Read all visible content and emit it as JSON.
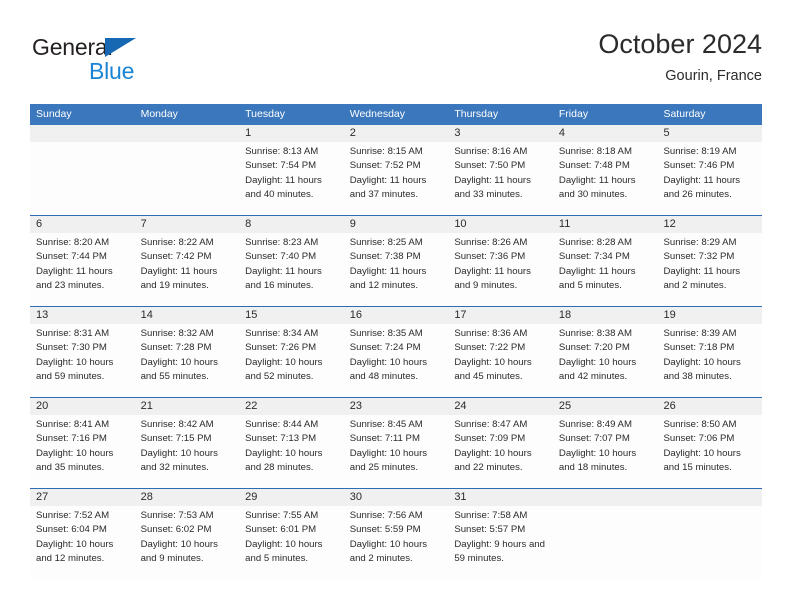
{
  "brand": {
    "name_part1": "General",
    "name_part2": "Blue",
    "triangle_color": "#1668b3",
    "blue_color": "#1c84d4"
  },
  "header": {
    "title": "October 2024",
    "subtitle": "Gourin, France"
  },
  "theme": {
    "header_blue": "#3b77bc",
    "row_separator_blue": "#2f6cb3",
    "daynum_band_gray": "#f0f0f0",
    "text_color": "#2b2b2b"
  },
  "weekdays": [
    "Sunday",
    "Monday",
    "Tuesday",
    "Wednesday",
    "Thursday",
    "Friday",
    "Saturday"
  ],
  "weeks": [
    [
      {
        "day": "",
        "sunrise": "",
        "sunset": "",
        "daylight": ""
      },
      {
        "day": "",
        "sunrise": "",
        "sunset": "",
        "daylight": ""
      },
      {
        "day": "1",
        "sunrise": "Sunrise: 8:13 AM",
        "sunset": "Sunset: 7:54 PM",
        "daylight": "Daylight: 11 hours and 40 minutes."
      },
      {
        "day": "2",
        "sunrise": "Sunrise: 8:15 AM",
        "sunset": "Sunset: 7:52 PM",
        "daylight": "Daylight: 11 hours and 37 minutes."
      },
      {
        "day": "3",
        "sunrise": "Sunrise: 8:16 AM",
        "sunset": "Sunset: 7:50 PM",
        "daylight": "Daylight: 11 hours and 33 minutes."
      },
      {
        "day": "4",
        "sunrise": "Sunrise: 8:18 AM",
        "sunset": "Sunset: 7:48 PM",
        "daylight": "Daylight: 11 hours and 30 minutes."
      },
      {
        "day": "5",
        "sunrise": "Sunrise: 8:19 AM",
        "sunset": "Sunset: 7:46 PM",
        "daylight": "Daylight: 11 hours and 26 minutes."
      }
    ],
    [
      {
        "day": "6",
        "sunrise": "Sunrise: 8:20 AM",
        "sunset": "Sunset: 7:44 PM",
        "daylight": "Daylight: 11 hours and 23 minutes."
      },
      {
        "day": "7",
        "sunrise": "Sunrise: 8:22 AM",
        "sunset": "Sunset: 7:42 PM",
        "daylight": "Daylight: 11 hours and 19 minutes."
      },
      {
        "day": "8",
        "sunrise": "Sunrise: 8:23 AM",
        "sunset": "Sunset: 7:40 PM",
        "daylight": "Daylight: 11 hours and 16 minutes."
      },
      {
        "day": "9",
        "sunrise": "Sunrise: 8:25 AM",
        "sunset": "Sunset: 7:38 PM",
        "daylight": "Daylight: 11 hours and 12 minutes."
      },
      {
        "day": "10",
        "sunrise": "Sunrise: 8:26 AM",
        "sunset": "Sunset: 7:36 PM",
        "daylight": "Daylight: 11 hours and 9 minutes."
      },
      {
        "day": "11",
        "sunrise": "Sunrise: 8:28 AM",
        "sunset": "Sunset: 7:34 PM",
        "daylight": "Daylight: 11 hours and 5 minutes."
      },
      {
        "day": "12",
        "sunrise": "Sunrise: 8:29 AM",
        "sunset": "Sunset: 7:32 PM",
        "daylight": "Daylight: 11 hours and 2 minutes."
      }
    ],
    [
      {
        "day": "13",
        "sunrise": "Sunrise: 8:31 AM",
        "sunset": "Sunset: 7:30 PM",
        "daylight": "Daylight: 10 hours and 59 minutes."
      },
      {
        "day": "14",
        "sunrise": "Sunrise: 8:32 AM",
        "sunset": "Sunset: 7:28 PM",
        "daylight": "Daylight: 10 hours and 55 minutes."
      },
      {
        "day": "15",
        "sunrise": "Sunrise: 8:34 AM",
        "sunset": "Sunset: 7:26 PM",
        "daylight": "Daylight: 10 hours and 52 minutes."
      },
      {
        "day": "16",
        "sunrise": "Sunrise: 8:35 AM",
        "sunset": "Sunset: 7:24 PM",
        "daylight": "Daylight: 10 hours and 48 minutes."
      },
      {
        "day": "17",
        "sunrise": "Sunrise: 8:36 AM",
        "sunset": "Sunset: 7:22 PM",
        "daylight": "Daylight: 10 hours and 45 minutes."
      },
      {
        "day": "18",
        "sunrise": "Sunrise: 8:38 AM",
        "sunset": "Sunset: 7:20 PM",
        "daylight": "Daylight: 10 hours and 42 minutes."
      },
      {
        "day": "19",
        "sunrise": "Sunrise: 8:39 AM",
        "sunset": "Sunset: 7:18 PM",
        "daylight": "Daylight: 10 hours and 38 minutes."
      }
    ],
    [
      {
        "day": "20",
        "sunrise": "Sunrise: 8:41 AM",
        "sunset": "Sunset: 7:16 PM",
        "daylight": "Daylight: 10 hours and 35 minutes."
      },
      {
        "day": "21",
        "sunrise": "Sunrise: 8:42 AM",
        "sunset": "Sunset: 7:15 PM",
        "daylight": "Daylight: 10 hours and 32 minutes."
      },
      {
        "day": "22",
        "sunrise": "Sunrise: 8:44 AM",
        "sunset": "Sunset: 7:13 PM",
        "daylight": "Daylight: 10 hours and 28 minutes."
      },
      {
        "day": "23",
        "sunrise": "Sunrise: 8:45 AM",
        "sunset": "Sunset: 7:11 PM",
        "daylight": "Daylight: 10 hours and 25 minutes."
      },
      {
        "day": "24",
        "sunrise": "Sunrise: 8:47 AM",
        "sunset": "Sunset: 7:09 PM",
        "daylight": "Daylight: 10 hours and 22 minutes."
      },
      {
        "day": "25",
        "sunrise": "Sunrise: 8:49 AM",
        "sunset": "Sunset: 7:07 PM",
        "daylight": "Daylight: 10 hours and 18 minutes."
      },
      {
        "day": "26",
        "sunrise": "Sunrise: 8:50 AM",
        "sunset": "Sunset: 7:06 PM",
        "daylight": "Daylight: 10 hours and 15 minutes."
      }
    ],
    [
      {
        "day": "27",
        "sunrise": "Sunrise: 7:52 AM",
        "sunset": "Sunset: 6:04 PM",
        "daylight": "Daylight: 10 hours and 12 minutes."
      },
      {
        "day": "28",
        "sunrise": "Sunrise: 7:53 AM",
        "sunset": "Sunset: 6:02 PM",
        "daylight": "Daylight: 10 hours and 9 minutes."
      },
      {
        "day": "29",
        "sunrise": "Sunrise: 7:55 AM",
        "sunset": "Sunset: 6:01 PM",
        "daylight": "Daylight: 10 hours and 5 minutes."
      },
      {
        "day": "30",
        "sunrise": "Sunrise: 7:56 AM",
        "sunset": "Sunset: 5:59 PM",
        "daylight": "Daylight: 10 hours and 2 minutes."
      },
      {
        "day": "31",
        "sunrise": "Sunrise: 7:58 AM",
        "sunset": "Sunset: 5:57 PM",
        "daylight": "Daylight: 9 hours and 59 minutes."
      },
      {
        "day": "",
        "sunrise": "",
        "sunset": "",
        "daylight": ""
      },
      {
        "day": "",
        "sunrise": "",
        "sunset": "",
        "daylight": ""
      }
    ]
  ]
}
